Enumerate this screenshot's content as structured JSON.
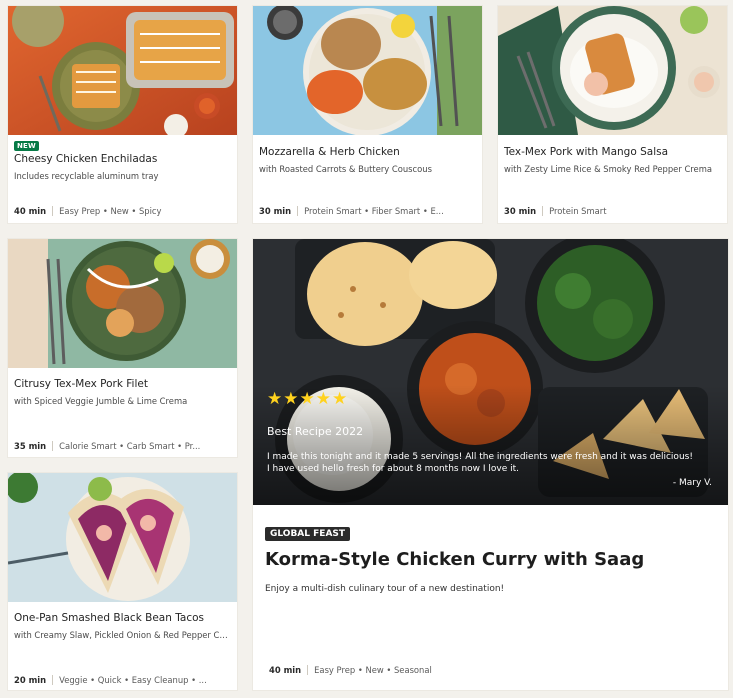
{
  "cards": [
    {
      "badge": "NEW",
      "title": "Cheesy Chicken Enchiladas",
      "subtitle": "Includes recyclable aluminum tray",
      "time": "40 min",
      "tags": "Easy Prep • New • Spicy"
    },
    {
      "title": "Mozzarella & Herb Chicken",
      "subtitle": "with Roasted Carrots & Buttery Couscous",
      "time": "30 min",
      "tags": "Protein Smart • Fiber Smart • E..."
    },
    {
      "title": "Tex-Mex Pork with Mango Salsa",
      "subtitle": "with Zesty Lime Rice & Smoky Red Pepper Crema",
      "time": "30 min",
      "tags": "Protein Smart"
    },
    {
      "title": "Citrusy Tex-Mex Pork Filet",
      "subtitle": "with Spiced Veggie Jumble & Lime Crema",
      "time": "35 min",
      "tags": "Calorie Smart • Carb Smart • Pr..."
    },
    {
      "title": "One-Pan Smashed Black Bean Tacos",
      "subtitle": "with Creamy Slaw, Pickled Onion & Red Pepper Cre...",
      "time": "20 min",
      "tags": "Veggie • Quick • Easy Cleanup • ..."
    }
  ],
  "featured": {
    "rating_stars": "★★★★★",
    "rating_value": 5,
    "award": "Best Recipe 2022",
    "review": "I made this tonight and it made 5 servings! All the ingredients were fresh and it was delicious! I have used hello fresh for about 8 months now I love it.",
    "reviewer": "- Mary V.",
    "badge": "GLOBAL FEAST",
    "title": "Korma-Style Chicken Curry with Saag",
    "subtitle": "Enjoy a multi-dish culinary tour of a new destination!",
    "time": "40 min",
    "tags": "Easy Prep • New • Seasonal"
  },
  "colors": {
    "new_badge": "#067a46",
    "star": "#ffd21e",
    "feature_badge": "#2b2b2b"
  }
}
